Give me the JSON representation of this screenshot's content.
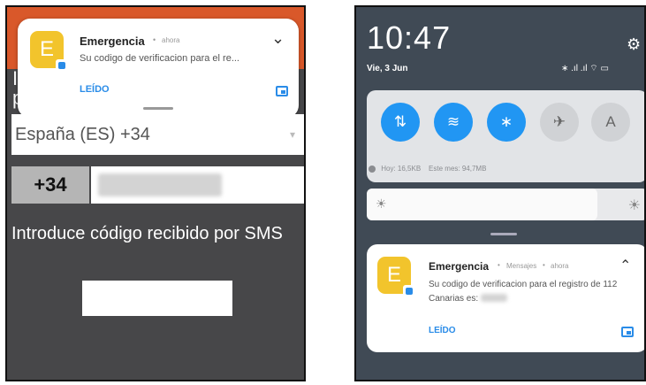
{
  "left_screen": {
    "side_text": "l\nr",
    "notification": {
      "app_icon_letter": "E",
      "title": "Emergencia",
      "separator": "•",
      "time": "ahora",
      "body": "Su codigo de verificacion para el re...",
      "action": "LEÍDO",
      "chevron": "⌄"
    },
    "country_select": {
      "value": "España (ES) +34",
      "caret": "▾"
    },
    "prefix": "+34",
    "code_label": "Introduce código recibido por SMS"
  },
  "right_screen": {
    "time": "10:47",
    "gear_icon": "⚙",
    "date": "Vie, 3 Jun",
    "status_icons": "∗ .ıl .ıl ⌔ ▭",
    "quick_tiles": [
      {
        "icon": "⇅",
        "name": "mobile-data",
        "state": "on"
      },
      {
        "icon": "≋",
        "name": "wifi",
        "state": "on"
      },
      {
        "icon": "∗",
        "name": "bluetooth",
        "state": "on"
      },
      {
        "icon": "✈",
        "name": "airplane",
        "state": "off"
      },
      {
        "icon": "A",
        "name": "auto-brightness",
        "state": "off"
      }
    ],
    "data_usage": {
      "today": "Hoy: 16,5KB",
      "month": "Este mes: 94,7MB"
    },
    "brightness_level": 0.82,
    "brightness_icons": {
      "low": "☀",
      "high": "☀"
    },
    "notification": {
      "app_icon_letter": "E",
      "title": "Emergencia",
      "separator": "•",
      "category": "Mensajes",
      "time": "ahora",
      "body": "Su codigo de verificacion para el registro de 112 Canarias es:",
      "action": "LEÍDO",
      "chevron": "⌃"
    }
  },
  "colors": {
    "accent_blue": "#2196f3",
    "app_icon_yellow": "#f2c42c",
    "left_topbar_orange": "#d9582a",
    "left_bg": "#474749",
    "right_bg": "#404a55"
  }
}
